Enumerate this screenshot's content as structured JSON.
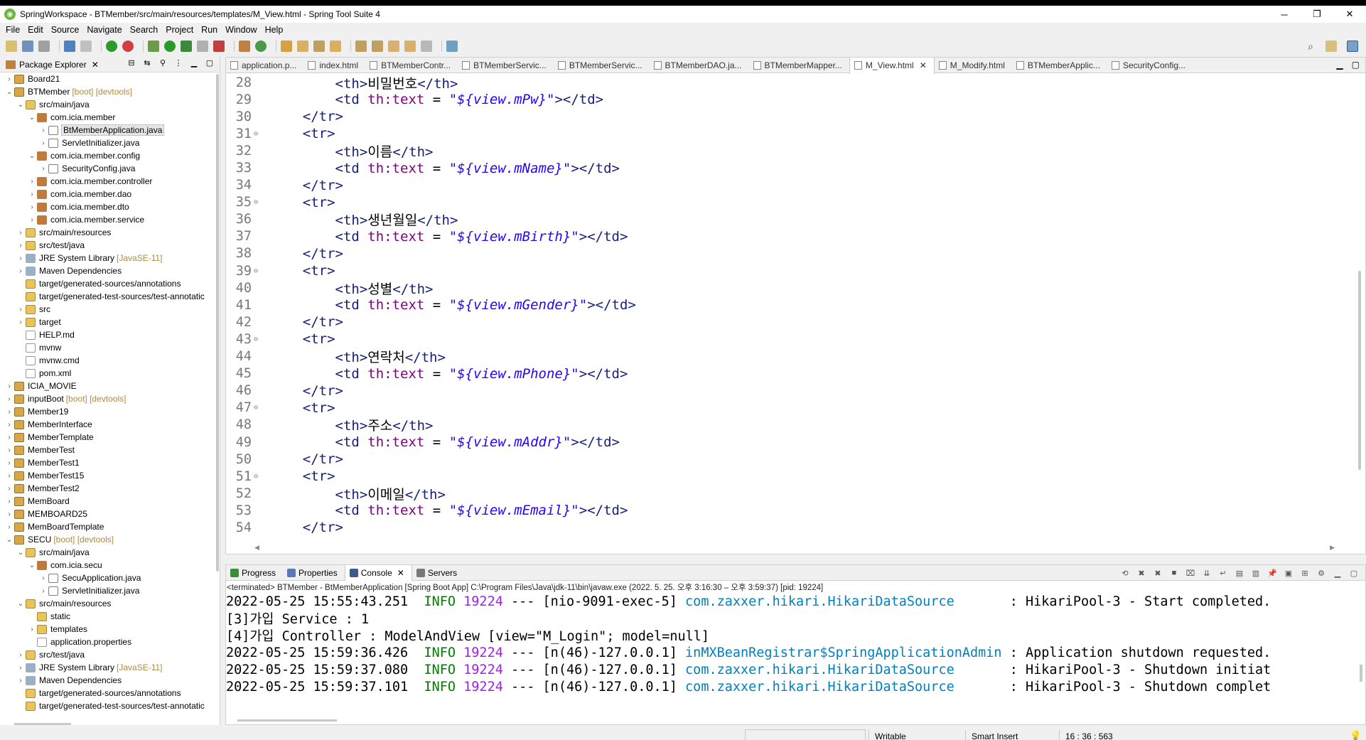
{
  "window": {
    "title": "SpringWorkspace - BTMember/src/main/resources/templates/M_View.html - Spring Tool Suite 4",
    "minimize": "─",
    "maximize": "❐",
    "close": "✕"
  },
  "menu": [
    "File",
    "Edit",
    "Source",
    "Navigate",
    "Search",
    "Project",
    "Run",
    "Window",
    "Help"
  ],
  "package_explorer": {
    "title": "Package Explorer",
    "close": "✕",
    "items": [
      {
        "indent": 0,
        "arrow": "›",
        "icon": "proj",
        "label": "Board21",
        "deco": ""
      },
      {
        "indent": 0,
        "arrow": "⌄",
        "icon": "proj",
        "label": "BTMember",
        "deco": "[boot] [devtools]"
      },
      {
        "indent": 1,
        "arrow": "⌄",
        "icon": "folder",
        "label": "src/main/java",
        "deco": ""
      },
      {
        "indent": 2,
        "arrow": "⌄",
        "icon": "pkg",
        "label": "com.icia.member",
        "deco": ""
      },
      {
        "indent": 3,
        "arrow": "›",
        "icon": "java",
        "label": "BtMemberApplication.java",
        "deco": "",
        "selected": true
      },
      {
        "indent": 3,
        "arrow": "›",
        "icon": "java",
        "label": "ServletInitializer.java",
        "deco": ""
      },
      {
        "indent": 2,
        "arrow": "⌄",
        "icon": "pkg",
        "label": "com.icia.member.config",
        "deco": ""
      },
      {
        "indent": 3,
        "arrow": "›",
        "icon": "java",
        "label": "SecurityConfig.java",
        "deco": ""
      },
      {
        "indent": 2,
        "arrow": "›",
        "icon": "pkg",
        "label": "com.icia.member.controller",
        "deco": ""
      },
      {
        "indent": 2,
        "arrow": "›",
        "icon": "pkg",
        "label": "com.icia.member.dao",
        "deco": ""
      },
      {
        "indent": 2,
        "arrow": "›",
        "icon": "pkg",
        "label": "com.icia.member.dto",
        "deco": ""
      },
      {
        "indent": 2,
        "arrow": "›",
        "icon": "pkg",
        "label": "com.icia.member.service",
        "deco": ""
      },
      {
        "indent": 1,
        "arrow": "›",
        "icon": "folder",
        "label": "src/main/resources",
        "deco": ""
      },
      {
        "indent": 1,
        "arrow": "›",
        "icon": "folder",
        "label": "src/test/java",
        "deco": ""
      },
      {
        "indent": 1,
        "arrow": "›",
        "icon": "lib",
        "label": "JRE System Library",
        "deco": "[JavaSE-11]"
      },
      {
        "indent": 1,
        "arrow": "›",
        "icon": "lib",
        "label": "Maven Dependencies",
        "deco": ""
      },
      {
        "indent": 1,
        "arrow": "",
        "icon": "folder",
        "label": "target/generated-sources/annotations",
        "deco": ""
      },
      {
        "indent": 1,
        "arrow": "",
        "icon": "folder",
        "label": "target/generated-test-sources/test-annotatic",
        "deco": ""
      },
      {
        "indent": 1,
        "arrow": "›",
        "icon": "folder",
        "label": "src",
        "deco": ""
      },
      {
        "indent": 1,
        "arrow": "›",
        "icon": "folder",
        "label": "target",
        "deco": ""
      },
      {
        "indent": 1,
        "arrow": "",
        "icon": "file",
        "label": "HELP.md",
        "deco": ""
      },
      {
        "indent": 1,
        "arrow": "",
        "icon": "file",
        "label": "mvnw",
        "deco": ""
      },
      {
        "indent": 1,
        "arrow": "",
        "icon": "file",
        "label": "mvnw.cmd",
        "deco": ""
      },
      {
        "indent": 1,
        "arrow": "",
        "icon": "file",
        "label": "pom.xml",
        "deco": ""
      },
      {
        "indent": 0,
        "arrow": "›",
        "icon": "proj",
        "label": "ICIA_MOVIE",
        "deco": ""
      },
      {
        "indent": 0,
        "arrow": "›",
        "icon": "proj",
        "label": "inputBoot",
        "deco": "[boot] [devtools]"
      },
      {
        "indent": 0,
        "arrow": "›",
        "icon": "proj",
        "label": "Member19",
        "deco": ""
      },
      {
        "indent": 0,
        "arrow": "›",
        "icon": "proj",
        "label": "MemberInterface",
        "deco": ""
      },
      {
        "indent": 0,
        "arrow": "›",
        "icon": "proj",
        "label": "MemberTemplate",
        "deco": ""
      },
      {
        "indent": 0,
        "arrow": "›",
        "icon": "proj",
        "label": "MemberTest",
        "deco": ""
      },
      {
        "indent": 0,
        "arrow": "›",
        "icon": "proj",
        "label": "MemberTest1",
        "deco": ""
      },
      {
        "indent": 0,
        "arrow": "›",
        "icon": "proj",
        "label": "MemberTest15",
        "deco": ""
      },
      {
        "indent": 0,
        "arrow": "›",
        "icon": "proj",
        "label": "MemberTest2",
        "deco": ""
      },
      {
        "indent": 0,
        "arrow": "›",
        "icon": "proj",
        "label": "MemBoard",
        "deco": ""
      },
      {
        "indent": 0,
        "arrow": "›",
        "icon": "proj",
        "label": "MEMBOARD25",
        "deco": ""
      },
      {
        "indent": 0,
        "arrow": "›",
        "icon": "proj",
        "label": "MemBoardTemplate",
        "deco": ""
      },
      {
        "indent": 0,
        "arrow": "⌄",
        "icon": "proj",
        "label": "SECU",
        "deco": "[boot] [devtools]"
      },
      {
        "indent": 1,
        "arrow": "⌄",
        "icon": "folder",
        "label": "src/main/java",
        "deco": ""
      },
      {
        "indent": 2,
        "arrow": "⌄",
        "icon": "pkg",
        "label": "com.icia.secu",
        "deco": ""
      },
      {
        "indent": 3,
        "arrow": "›",
        "icon": "java",
        "label": "SecuApplication.java",
        "deco": ""
      },
      {
        "indent": 3,
        "arrow": "›",
        "icon": "java",
        "label": "ServletInitializer.java",
        "deco": ""
      },
      {
        "indent": 1,
        "arrow": "⌄",
        "icon": "folder",
        "label": "src/main/resources",
        "deco": ""
      },
      {
        "indent": 2,
        "arrow": "",
        "icon": "folder",
        "label": "static",
        "deco": ""
      },
      {
        "indent": 2,
        "arrow": "›",
        "icon": "folder",
        "label": "templates",
        "deco": ""
      },
      {
        "indent": 2,
        "arrow": "",
        "icon": "file",
        "label": "application.properties",
        "deco": ""
      },
      {
        "indent": 1,
        "arrow": "›",
        "icon": "folder",
        "label": "src/test/java",
        "deco": ""
      },
      {
        "indent": 1,
        "arrow": "›",
        "icon": "lib",
        "label": "JRE System Library",
        "deco": "[JavaSE-11]"
      },
      {
        "indent": 1,
        "arrow": "›",
        "icon": "lib",
        "label": "Maven Dependencies",
        "deco": ""
      },
      {
        "indent": 1,
        "arrow": "",
        "icon": "folder",
        "label": "target/generated-sources/annotations",
        "deco": ""
      },
      {
        "indent": 1,
        "arrow": "",
        "icon": "folder",
        "label": "target/generated-test-sources/test-annotatic",
        "deco": ""
      }
    ]
  },
  "editor": {
    "tabs": [
      {
        "label": "application.p...",
        "active": false
      },
      {
        "label": "index.html",
        "active": false
      },
      {
        "label": "BTMemberContr...",
        "active": false
      },
      {
        "label": "BTMemberServic...",
        "active": false
      },
      {
        "label": "BTMemberServic...",
        "active": false
      },
      {
        "label": "BTMemberDAO.ja...",
        "active": false
      },
      {
        "label": "BTMemberMapper...",
        "active": false
      },
      {
        "label": "M_View.html",
        "active": true
      },
      {
        "label": "M_Modify.html",
        "active": false
      },
      {
        "label": "BTMemberApplic...",
        "active": false
      },
      {
        "label": "SecurityConfig...",
        "active": false
      }
    ],
    "lines": [
      {
        "n": "28",
        "fold": "",
        "indent": "        ",
        "kind": "th",
        "text": "비밀번호"
      },
      {
        "n": "29",
        "fold": "",
        "indent": "        ",
        "kind": "td",
        "text": "${view.mPw}"
      },
      {
        "n": "30",
        "fold": "",
        "indent": "    ",
        "kind": "close",
        "text": "</tr>"
      },
      {
        "n": "31",
        "fold": "⊖",
        "indent": "    ",
        "kind": "open",
        "text": "<tr>"
      },
      {
        "n": "32",
        "fold": "",
        "indent": "        ",
        "kind": "th",
        "text": "이름"
      },
      {
        "n": "33",
        "fold": "",
        "indent": "        ",
        "kind": "td",
        "text": "${view.mName}"
      },
      {
        "n": "34",
        "fold": "",
        "indent": "    ",
        "kind": "close",
        "text": "</tr>"
      },
      {
        "n": "35",
        "fold": "⊖",
        "indent": "    ",
        "kind": "open",
        "text": "<tr>"
      },
      {
        "n": "36",
        "fold": "",
        "indent": "        ",
        "kind": "th",
        "text": "생년월일"
      },
      {
        "n": "37",
        "fold": "",
        "indent": "        ",
        "kind": "td",
        "text": "${view.mBirth}"
      },
      {
        "n": "38",
        "fold": "",
        "indent": "    ",
        "kind": "close",
        "text": "</tr>"
      },
      {
        "n": "39",
        "fold": "⊖",
        "indent": "    ",
        "kind": "open",
        "text": "<tr>"
      },
      {
        "n": "40",
        "fold": "",
        "indent": "        ",
        "kind": "th",
        "text": "성별"
      },
      {
        "n": "41",
        "fold": "",
        "indent": "        ",
        "kind": "td",
        "text": "${view.mGender}"
      },
      {
        "n": "42",
        "fold": "",
        "indent": "    ",
        "kind": "close",
        "text": "</tr>"
      },
      {
        "n": "43",
        "fold": "⊖",
        "indent": "    ",
        "kind": "open",
        "text": "<tr>"
      },
      {
        "n": "44",
        "fold": "",
        "indent": "        ",
        "kind": "th",
        "text": "연락처"
      },
      {
        "n": "45",
        "fold": "",
        "indent": "        ",
        "kind": "td",
        "text": "${view.mPhone}"
      },
      {
        "n": "46",
        "fold": "",
        "indent": "    ",
        "kind": "close",
        "text": "</tr>"
      },
      {
        "n": "47",
        "fold": "⊖",
        "indent": "    ",
        "kind": "open",
        "text": "<tr>"
      },
      {
        "n": "48",
        "fold": "",
        "indent": "        ",
        "kind": "th",
        "text": "주소"
      },
      {
        "n": "49",
        "fold": "",
        "indent": "        ",
        "kind": "td",
        "text": "${view.mAddr}"
      },
      {
        "n": "50",
        "fold": "",
        "indent": "    ",
        "kind": "close",
        "text": "</tr>"
      },
      {
        "n": "51",
        "fold": "⊖",
        "indent": "    ",
        "kind": "open",
        "text": "<tr>"
      },
      {
        "n": "52",
        "fold": "",
        "indent": "        ",
        "kind": "th",
        "text": "이메일"
      },
      {
        "n": "53",
        "fold": "",
        "indent": "        ",
        "kind": "td",
        "text": "${view.mEmail}"
      },
      {
        "n": "54",
        "fold": "",
        "indent": "    ",
        "kind": "close",
        "text": "</tr>"
      }
    ]
  },
  "console": {
    "tabs": [
      {
        "label": "Progress",
        "active": false,
        "color": "#3c8c3c"
      },
      {
        "label": "Properties",
        "active": false,
        "color": "#5a78b4"
      },
      {
        "label": "Console",
        "active": true,
        "color": "#3c5a8c"
      },
      {
        "label": "Servers",
        "active": false,
        "color": "#787878"
      }
    ],
    "terminated": "<terminated> BTMember - BtMemberApplication [Spring Boot App] C:\\Program Files\\Java\\jdk-11\\bin\\javaw.exe  (2022. 5. 25. 오후 3:16:30 – 오후 3:59:37) [pid: 19224]",
    "lines": [
      {
        "pre": "2022-05-25 15:55:43.251  ",
        "level": "INFO",
        "pid": "19224",
        "mid": " --- [nio-9091-exec-5] ",
        "cls": "com.zaxxer.hikari.HikariDataSource      ",
        "msg": " : HikariPool-3 - Start completed."
      },
      {
        "pre": "[3]가입 Service : 1",
        "level": "",
        "pid": "",
        "mid": "",
        "cls": "",
        "msg": ""
      },
      {
        "pre": "[4]가입 Controller : ModelAndView [view=\"M_Login\"; model=null]",
        "level": "",
        "pid": "",
        "mid": "",
        "cls": "",
        "msg": ""
      },
      {
        "pre": "2022-05-25 15:59:36.426  ",
        "level": "INFO",
        "pid": "19224",
        "mid": " --- [n(46)-127.0.0.1] ",
        "cls": "inMXBeanRegistrar$SpringApplicationAdmin",
        "msg": " : Application shutdown requested."
      },
      {
        "pre": "2022-05-25 15:59:37.080  ",
        "level": "INFO",
        "pid": "19224",
        "mid": " --- [n(46)-127.0.0.1] ",
        "cls": "com.zaxxer.hikari.HikariDataSource      ",
        "msg": " : HikariPool-3 - Shutdown initiat"
      },
      {
        "pre": "2022-05-25 15:59:37.101  ",
        "level": "INFO",
        "pid": "19224",
        "mid": " --- [n(46)-127.0.0.1] ",
        "cls": "com.zaxxer.hikari.HikariDataSource      ",
        "msg": " : HikariPool-3 - Shutdown complet"
      }
    ]
  },
  "status": {
    "writable": "Writable",
    "insert_mode": "Smart Insert",
    "position": "16 : 36 : 563"
  },
  "code_tokens": {
    "th_open": "<th>",
    "th_close": "</th>",
    "td_open": "<td ",
    "td_attr": "th:text",
    "eq": " = ",
    "td_end": "></td>"
  },
  "colors": {
    "tag": "#17207a",
    "attr": "#7f007f",
    "string": "#2a00ff",
    "info": "#008000",
    "class_link": "#0080c0"
  }
}
